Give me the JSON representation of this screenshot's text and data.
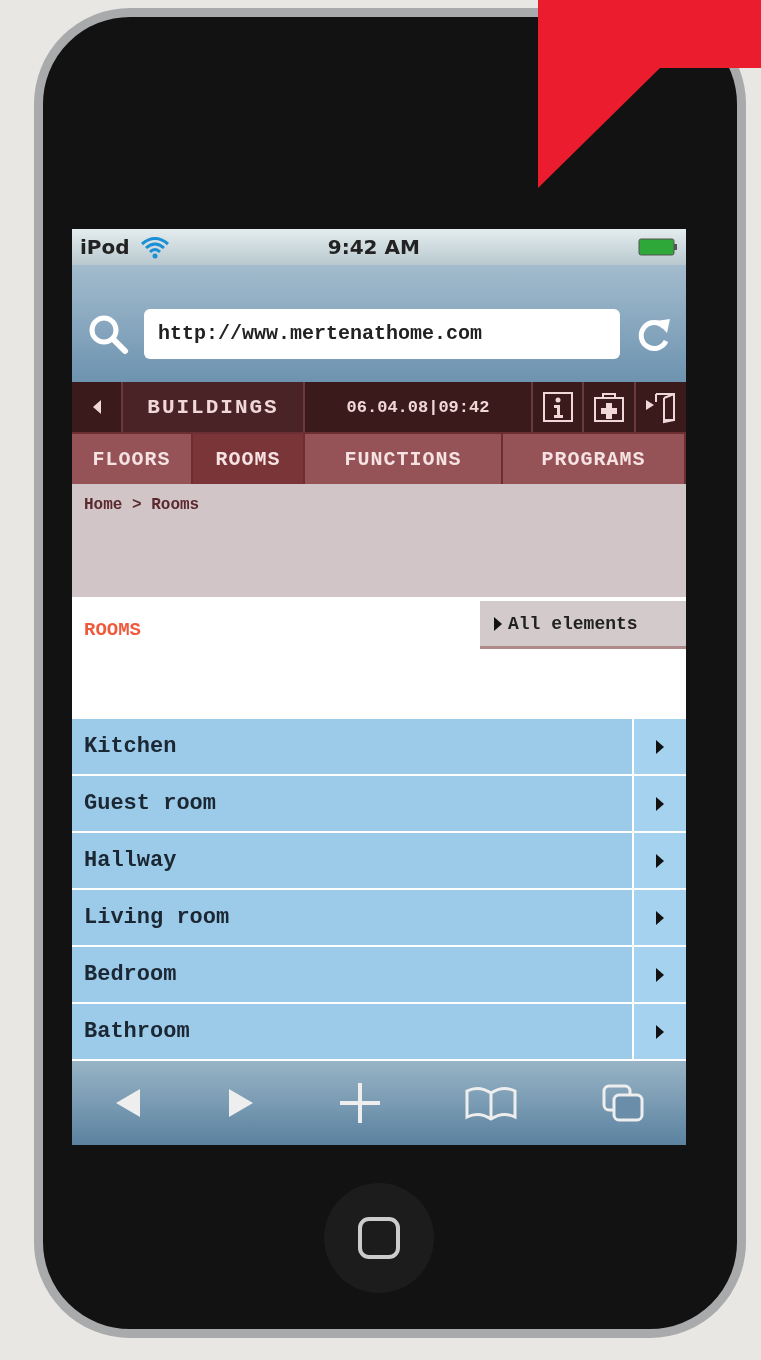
{
  "status_bar": {
    "carrier": "iPod",
    "time": "9:42 AM"
  },
  "address_bar": {
    "url": "http://www.mertenathome.com"
  },
  "nav_bar": {
    "building": "BUILDINGS",
    "datetime": "06.04.08|09:42"
  },
  "tabs": [
    {
      "label": "FLOORS",
      "selected": false
    },
    {
      "label": "ROOMS",
      "selected": true
    },
    {
      "label": "FUNCTIONS",
      "selected": false
    },
    {
      "label": "PROGRAMS",
      "selected": false
    }
  ],
  "breadcrumb": "Home > Rooms",
  "section": {
    "title": "ROOMS",
    "button": "All elements"
  },
  "rooms": [
    {
      "name": "Kitchen"
    },
    {
      "name": "Guest room"
    },
    {
      "name": "Hallway"
    },
    {
      "name": "Living room"
    },
    {
      "name": "Bedroom"
    },
    {
      "name": "Bathroom"
    }
  ]
}
